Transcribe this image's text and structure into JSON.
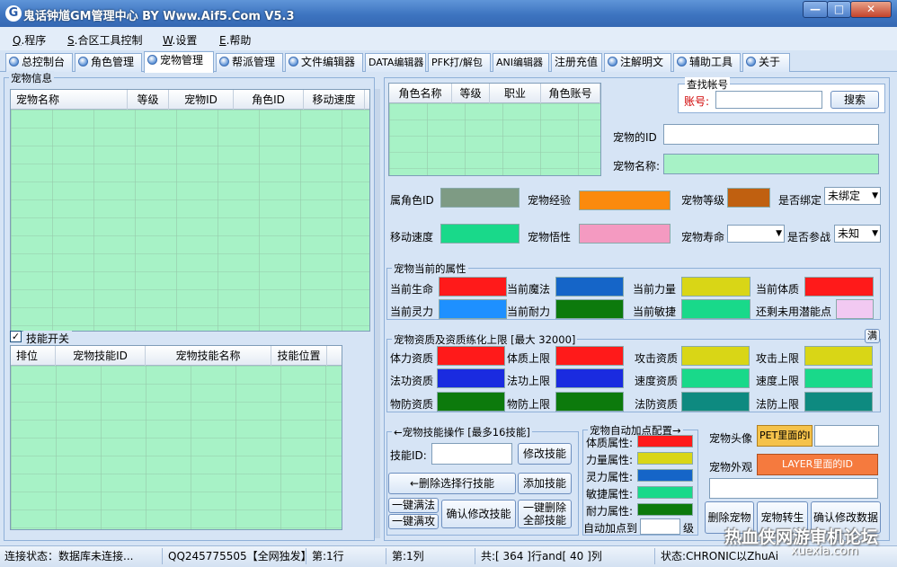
{
  "window": {
    "title": "鬼话钟馗GM管理中心 BY Www.Aif5.Com  V5.3",
    "app_icon": "G",
    "min": "—",
    "max": "□",
    "close": "✕"
  },
  "menu": [
    {
      "key": "Q",
      "label": ".程序"
    },
    {
      "key": "S",
      "label": ".合区工具控制"
    },
    {
      "key": "W",
      "label": ".设置"
    },
    {
      "key": "E",
      "label": ".帮助"
    }
  ],
  "tabs": [
    "总控制台",
    "角色管理",
    "宠物管理",
    "帮派管理",
    "文件编辑器",
    "DATA编辑器",
    "PFK打/解包",
    "ANI编辑器",
    "注册充值",
    "注解明文",
    "辅助工具",
    "关于"
  ],
  "active_tab": "宠物管理",
  "pet_info": {
    "title": "宠物信息",
    "columns": [
      "宠物名称",
      "等级",
      "宠物ID",
      "角色ID",
      "移动速度"
    ]
  },
  "skill": {
    "checkbox_label": "技能开关",
    "checked": true,
    "columns": [
      "排位",
      "宠物技能ID",
      "宠物技能名称",
      "技能位置"
    ]
  },
  "role_grid": {
    "columns": [
      "角色名称",
      "等级",
      "职业",
      "角色账号"
    ]
  },
  "search": {
    "title": "查找帐号",
    "label": "账号:",
    "button": "搜索"
  },
  "pet_fields": {
    "pet_id": "宠物的ID",
    "pet_name": "宠物名称:"
  },
  "props": {
    "owner_id": "属角色ID",
    "exp": "宠物经验",
    "level": "宠物等级",
    "bound": "是否绑定",
    "bound_value": "未绑定",
    "speed": "移动速度",
    "wuxing": "宠物悟性",
    "life": "宠物寿命",
    "battle": "是否参战",
    "battle_value": "未知"
  },
  "current_attr": {
    "title": "宠物当前的属性",
    "items": [
      {
        "label": "当前生命",
        "color": "#ff1a1a"
      },
      {
        "label": "当前魔法",
        "color": "#1565c8"
      },
      {
        "label": "当前力量",
        "color": "#d9d616"
      },
      {
        "label": "当前体质",
        "color": "#ff1a1a"
      },
      {
        "label": "当前灵力",
        "color": "#1e90ff"
      },
      {
        "label": "当前耐力",
        "color": "#0c7a0c"
      },
      {
        "label": "当前敏捷",
        "color": "#19d98a"
      },
      {
        "label": "还剩未用潜能点",
        "color": "#f2c9f2"
      }
    ]
  },
  "aptitude": {
    "title": "宠物资质及资质练化上限 [最大 32000]",
    "corner_button": "满",
    "items": [
      {
        "label": "体力资质",
        "color": "#ff1a1a"
      },
      {
        "label": "体质上限",
        "color": "#ff1a1a"
      },
      {
        "label": "攻击资质",
        "color": "#d9d616"
      },
      {
        "label": "攻击上限",
        "color": "#d9d616"
      },
      {
        "label": "法功资质",
        "color": "#1a2be0"
      },
      {
        "label": "法功上限",
        "color": "#1a2be0"
      },
      {
        "label": "速度资质",
        "color": "#19d98a"
      },
      {
        "label": "速度上限",
        "color": "#19d98a"
      },
      {
        "label": "物防资质",
        "color": "#0c7a0c"
      },
      {
        "label": "物防上限",
        "color": "#0c7a0c"
      },
      {
        "label": "法防资质",
        "color": "#0e8a80"
      },
      {
        "label": "法防上限",
        "color": "#0e8a80"
      }
    ]
  },
  "skill_ops": {
    "title": "←宠物技能操作 [最多16技能]",
    "skill_id_label": "技能ID:",
    "modify": "修改技能",
    "delete_row": "←删除选择行技能",
    "add": "添加技能",
    "one_full_1": "一键满法",
    "one_full_2": "一键满攻",
    "confirm": "确认修改技能",
    "one_delete": "一键删除全部技能"
  },
  "auto_points": {
    "title": "宠物自动加点配置→",
    "items": [
      {
        "label": "体质属性:",
        "color": "#ff1a1a"
      },
      {
        "label": "力量属性:",
        "color": "#d9d616"
      },
      {
        "label": "灵力属性:",
        "color": "#1565c8"
      },
      {
        "label": "敏捷属性:",
        "color": "#19d98a"
      },
      {
        "label": "耐力属性:",
        "color": "#0c7a0c"
      }
    ],
    "auto_to": "自动加点到",
    "unit": "级"
  },
  "appearance": {
    "avatar_label": "宠物头像",
    "avatar_hint": "PET里面的I",
    "avatar_hint_color": "#f5c24a",
    "look_label": "宠物外观",
    "look_hint": "LAYER里面的ID",
    "look_hint_color": "#f57a3e"
  },
  "bottom_buttons": [
    "删除宠物",
    "宠物转生",
    "确认修改数据"
  ],
  "status": {
    "conn": "连接状态：数据库未连接...",
    "qq": "QQ245775505【全网独发】",
    "row": "第:1行",
    "col": "第:1列",
    "total": "共:[ 364 ]行and[ 40 ]列",
    "state": "状态:CHRONIC以ZhuAi"
  },
  "watermark": {
    "line1": "热血侠网游审机论坛",
    "line2": "xuexia.com"
  },
  "colors": {
    "grid_green": "#a7f2c6",
    "owner_id": "#7e9b84",
    "exp": "#fb8a0d",
    "level": "#c06010",
    "speed": "#19d98a",
    "wuxing": "#f49ac1",
    "pet_name_field": "#a7f2c6"
  }
}
